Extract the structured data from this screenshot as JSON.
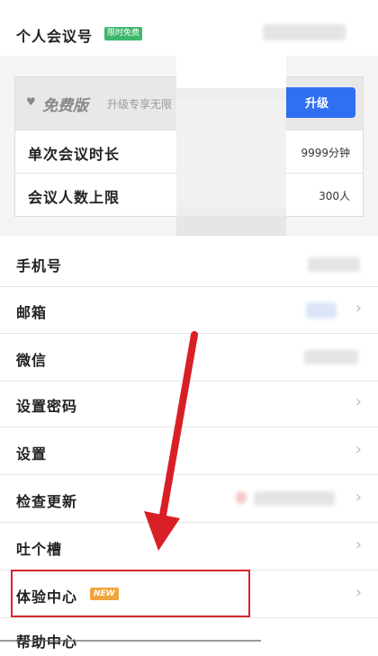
{
  "personal_meeting": {
    "label": "个人会议号",
    "badge": "限时免费"
  },
  "plan": {
    "name": "免费版",
    "promo": "升级专享无限",
    "upgrade_label": "升级",
    "rows": [
      {
        "label": "单次会议时长",
        "value": "9999分钟"
      },
      {
        "label": "会议人数上限",
        "value": "300人"
      }
    ]
  },
  "list": {
    "phone": "手机号",
    "email": "邮箱",
    "wechat": "微信",
    "password": "设置密码",
    "settings": "设置",
    "check_update": "检查更新",
    "feedback": "吐个槽",
    "experience_center": "体验中心",
    "experience_badge": "NEW",
    "help_partial": "帮助中心"
  },
  "colors": {
    "accent": "#2f6ff2",
    "highlight": "#d8252c",
    "free_badge": "#3db86b",
    "new_badge": "#f0a53b"
  },
  "icons": {
    "chevron": "chevron-right-icon",
    "heart": "heart-icon",
    "arrow": "red-arrow-icon"
  }
}
